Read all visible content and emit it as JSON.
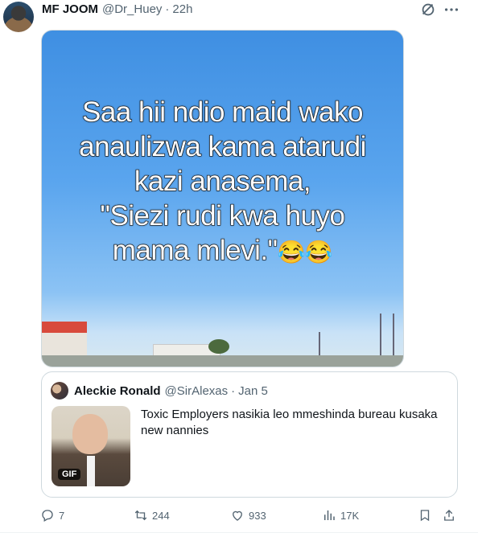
{
  "post": {
    "author_name": "MF JOOM",
    "author_handle": "@Dr_Huey",
    "separator": "·",
    "time": "22h"
  },
  "media": {
    "caption_lines": [
      "Saa hii ndio maid wako",
      "anaulizwa kama atarudi",
      "kazi anasema,",
      "\"Siezi rudi kwa huyo"
    ],
    "caption_last_line": "mama mlevi.\"",
    "caption_emojis": "😂😂"
  },
  "quote": {
    "author_name": "Aleckie Ronald",
    "author_handle": "@SirAlexas",
    "separator": "·",
    "time": "Jan 5",
    "text": "Toxic Employers nasikia leo mmeshinda bureau kusaka new nannies",
    "gif_badge": "GIF"
  },
  "actions": {
    "replies": "7",
    "reposts": "244",
    "likes": "933",
    "views": "17K"
  },
  "icons": {
    "grok": "grok-icon",
    "more": "more-icon",
    "reply": "reply-icon",
    "repost": "repost-icon",
    "like": "like-icon",
    "views": "views-icon",
    "bookmark": "bookmark-icon",
    "share": "share-icon"
  }
}
